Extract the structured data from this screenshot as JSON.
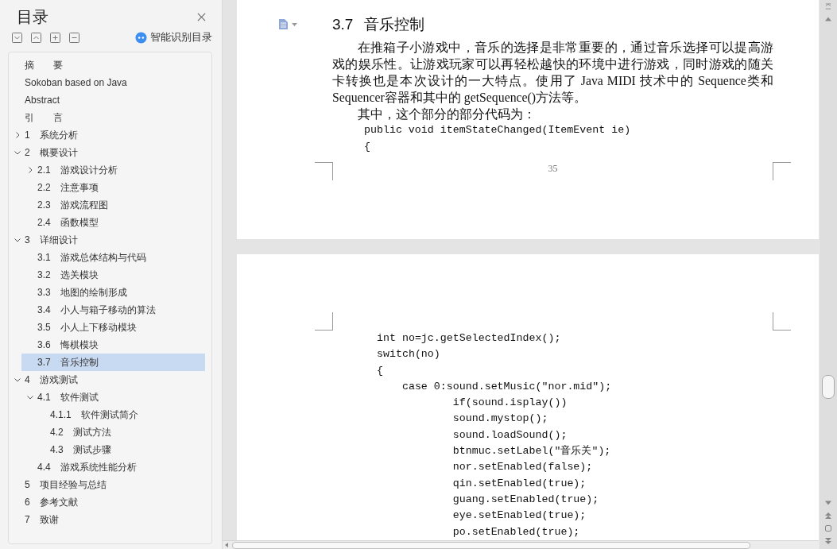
{
  "sidebar": {
    "title": "目录",
    "smart_toc": "智能识别目录",
    "tree": [
      {
        "title": "摘　　要",
        "selected": false
      },
      {
        "title": "Sokoban based on Java",
        "selected": false
      },
      {
        "title": "Abstract",
        "selected": false
      },
      {
        "title": "引　　言",
        "selected": false
      },
      {
        "number": "1",
        "title": "系统分析",
        "selected": false,
        "expanded": false
      },
      {
        "number": "2",
        "title": "概要设计",
        "selected": false,
        "expanded": true,
        "children": [
          {
            "number": "2.1",
            "title": "游戏设计分析",
            "selected": false,
            "expanded": false
          },
          {
            "number": "2.2",
            "title": "注意事项",
            "selected": false
          },
          {
            "number": "2.3",
            "title": "游戏流程图",
            "selected": false
          },
          {
            "number": "2.4",
            "title": "函数模型",
            "selected": false
          }
        ]
      },
      {
        "number": "3",
        "title": "详细设计",
        "selected": false,
        "expanded": true,
        "children": [
          {
            "number": "3.1",
            "title": "游戏总体结构与代码",
            "selected": false
          },
          {
            "number": "3.2",
            "title": "选关模块",
            "selected": false
          },
          {
            "number": "3.3",
            "title": "地图的绘制形成",
            "selected": false
          },
          {
            "number": "3.4",
            "title": "小人与箱子移动的算法",
            "selected": false
          },
          {
            "number": "3.5",
            "title": "小人上下移动模块",
            "selected": false
          },
          {
            "number": "3.6",
            "title": "悔棋模块",
            "selected": false
          },
          {
            "number": "3.7",
            "title": "音乐控制",
            "selected": true
          }
        ]
      },
      {
        "number": "4",
        "title": "游戏测试",
        "selected": false,
        "expanded": true,
        "children": [
          {
            "number": "4.1",
            "title": "软件测试",
            "selected": false,
            "expanded": true,
            "children": [
              {
                "number": "4.1.1",
                "title": "软件测试简介",
                "selected": false
              },
              {
                "number": "4.2",
                "title": "测试方法",
                "selected": false
              },
              {
                "number": "4.3",
                "title": "测试步骤",
                "selected": false
              }
            ]
          },
          {
            "number": "4.4",
            "title": "游戏系统性能分析",
            "selected": false
          }
        ]
      },
      {
        "number": "5",
        "title": "项目经验与总结",
        "selected": false
      },
      {
        "number": "6",
        "title": "参考文献",
        "selected": false
      },
      {
        "number": "7",
        "title": "致谢",
        "selected": false
      }
    ]
  },
  "document": {
    "page1": {
      "heading_number": "3.7",
      "heading_title": "音乐控制",
      "paragraphs": [
        "在推箱子小游戏中，音乐的选择是非常重要的，通过音乐选择可以提高游戏的娱乐性。让游戏玩家可以再轻松越快的环境中进行游戏，同时游戏的随关卡转换也是本次设计的一大特点。使用了 Java MIDI 技术中的 Sequence类和 Sequencer容器和其中的 getSequence()方法等。",
        "其中，这个部分的部分代码为："
      ],
      "code": [
        "public void itemStateChanged(ItemEvent ie)",
        "{"
      ],
      "page_number": "35"
    },
    "page2": {
      "code": [
        "int no=jc.getSelectedIndex();",
        "switch(no)",
        "{",
        "    case 0:sound.setMusic(\"nor.mid\");",
        "            if(sound.isplay())",
        "            sound.mystop();",
        "            sound.loadSound();",
        "            btnmuc.setLabel(\"音乐关\");",
        "            nor.setEnabled(false);",
        "            qin.setEnabled(true);",
        "            guang.setEnabled(true);",
        "            eye.setEnabled(true);",
        "            po.setEnabled(true);"
      ]
    }
  }
}
